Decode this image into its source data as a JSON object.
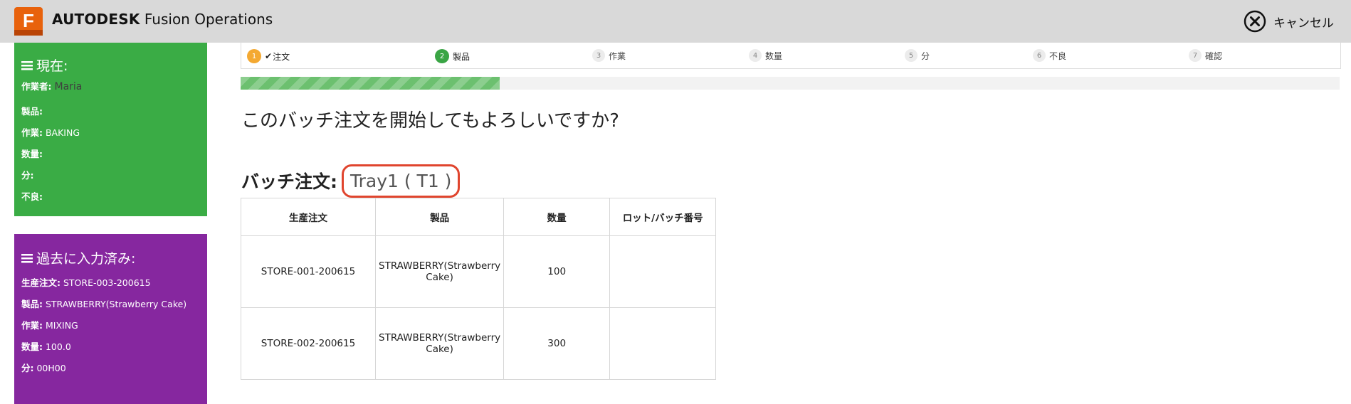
{
  "header": {
    "brand_bold": "AUTODESK",
    "brand_rest": "Fusion Operations",
    "logo_letter": "F",
    "cancel_label": "キャンセル",
    "cancel_icon": "close-circle-icon"
  },
  "current": {
    "title": "現在:",
    "operator_label": "作業者:",
    "operator_value": "Maria",
    "product_label": "製品:",
    "product_value": "",
    "operation_label": "作業:",
    "operation_value": "BAKING",
    "quantity_label": "数量:",
    "quantity_value": "",
    "minutes_label": "分:",
    "minutes_value": "",
    "defects_label": "不良:",
    "defects_value": ""
  },
  "past": {
    "title": "過去に入力済み:",
    "order_label": "生産注文:",
    "order_value": "STORE-003-200615",
    "product_label": "製品:",
    "product_value": "STRAWBERRY(Strawberry Cake)",
    "operation_label": "作業:",
    "operation_value": "MIXING",
    "quantity_label": "数量:",
    "quantity_value": "100.0",
    "minutes_label": "分:",
    "minutes_value": "00H00"
  },
  "steps": [
    {
      "num": "1",
      "label": "注文",
      "state": "done"
    },
    {
      "num": "2",
      "label": "製品",
      "state": "active"
    },
    {
      "num": "3",
      "label": "作業",
      "state": "pending"
    },
    {
      "num": "4",
      "label": "数量",
      "state": "pending"
    },
    {
      "num": "5",
      "label": "分",
      "state": "pending"
    },
    {
      "num": "6",
      "label": "不良",
      "state": "pending"
    },
    {
      "num": "7",
      "label": "確認",
      "state": "pending"
    }
  ],
  "progress_fraction": 0.236,
  "question": "このバッチ注文を開始してもよろしいですか?",
  "batch": {
    "label": "バッチ注文:",
    "value": "Tray1 ( T1 )"
  },
  "table": {
    "headers": [
      "生産注文",
      "製品",
      "数量",
      "ロット/バッチ番号"
    ],
    "rows": [
      [
        "STORE-001-200615",
        "STRAWBERRY(Strawberry Cake)",
        "100",
        ""
      ],
      [
        "STORE-002-200615",
        "STRAWBERRY(Strawberry Cake)",
        "300",
        ""
      ]
    ]
  },
  "colors": {
    "current_panel": "#3aac45",
    "past_panel": "#86279f",
    "accent_orange": "#f4a932",
    "progress_green": "#6cc06f",
    "highlight_red": "#e0452e"
  }
}
